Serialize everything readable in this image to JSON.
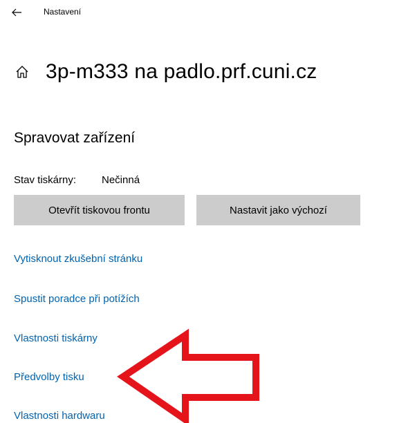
{
  "topbar": {
    "back_icon": "arrow-left-icon",
    "title": "Nastavení"
  },
  "header": {
    "icon": "home-icon",
    "title": "3p-m333 na padlo.prf.cuni.cz"
  },
  "section": {
    "title": "Spravovat zařízení"
  },
  "status": {
    "label": "Stav tiskárny:",
    "value": "Nečinná"
  },
  "buttons": {
    "open_queue": "Otevřít tiskovou frontu",
    "set_default": "Nastavit jako výchozí"
  },
  "links": [
    {
      "label": "Vytisknout zkušební stránku"
    },
    {
      "label": "Spustit poradce při potížích"
    },
    {
      "label": "Vlastnosti tiskárny"
    },
    {
      "label": "Předvolby tisku"
    },
    {
      "label": "Vlastnosti hardwaru"
    }
  ],
  "colors": {
    "link": "#0063b1",
    "button_bg": "#cccccc",
    "annotation_arrow": "#e5141b"
  }
}
